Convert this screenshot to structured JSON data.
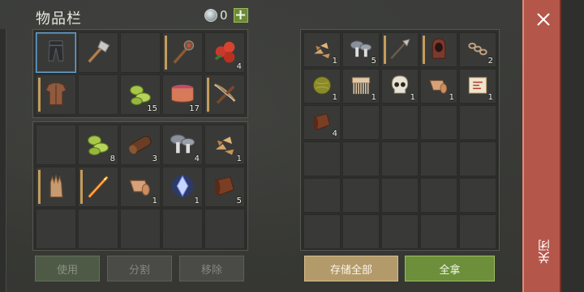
{
  "title": "物品栏",
  "currency": {
    "icon": "gem-icon",
    "count": "0",
    "add_label": "+"
  },
  "left_panel": {
    "equipment_slots": [
      {
        "icon": "pants-icon",
        "count": "",
        "selected": true,
        "marked": false
      },
      {
        "icon": "stone-axe-icon",
        "count": "",
        "selected": false,
        "marked": false
      },
      {
        "icon": "empty",
        "count": "",
        "selected": false,
        "marked": false
      },
      {
        "icon": "spiked-club-icon",
        "count": "",
        "selected": false,
        "marked": true
      },
      {
        "icon": "berries-icon",
        "count": "4",
        "selected": false,
        "marked": false
      },
      {
        "icon": "leather-armor-icon",
        "count": "",
        "selected": false,
        "marked": true
      },
      {
        "icon": "empty",
        "count": "",
        "selected": false,
        "marked": false
      },
      {
        "icon": "green-cloth-icon",
        "count": "15",
        "selected": false,
        "marked": false
      },
      {
        "icon": "bowl-icon",
        "count": "17",
        "selected": false,
        "marked": false
      },
      {
        "icon": "crossbow-icon",
        "count": "",
        "selected": false,
        "marked": true
      }
    ],
    "bag_slots": [
      {
        "icon": "empty",
        "count": ""
      },
      {
        "icon": "green-cloth-icon",
        "count": "8"
      },
      {
        "icon": "log-icon",
        "count": "3"
      },
      {
        "icon": "mushroom-icon",
        "count": "4"
      },
      {
        "icon": "wood-chips-icon",
        "count": "1"
      },
      {
        "icon": "glove-icon",
        "count": "",
        "marked": true
      },
      {
        "icon": "fire-sword-icon",
        "count": "",
        "marked": true
      },
      {
        "icon": "leather-roll-icon",
        "count": "1"
      },
      {
        "icon": "crystal-icon",
        "count": "1"
      },
      {
        "icon": "leather-scroll-icon",
        "count": "5"
      },
      {
        "icon": "empty",
        "count": ""
      },
      {
        "icon": "empty",
        "count": ""
      },
      {
        "icon": "empty",
        "count": ""
      },
      {
        "icon": "empty",
        "count": ""
      },
      {
        "icon": "empty",
        "count": ""
      }
    ],
    "buttons": {
      "use": "使用",
      "split": "分割",
      "remove": "移除"
    }
  },
  "right_panel": {
    "slots": [
      {
        "icon": "wood-chips-icon",
        "count": "1"
      },
      {
        "icon": "mushroom-icon",
        "count": "5"
      },
      {
        "icon": "halberd-icon",
        "count": "",
        "marked": true
      },
      {
        "icon": "hood-icon",
        "count": "",
        "marked": true
      },
      {
        "icon": "chain-icon",
        "count": "2"
      },
      {
        "icon": "moss-ball-icon",
        "count": "1"
      },
      {
        "icon": "comb-icon",
        "count": "1"
      },
      {
        "icon": "skull-icon",
        "count": "1"
      },
      {
        "icon": "leather-roll-icon",
        "count": "1"
      },
      {
        "icon": "map-scroll-icon",
        "count": "1"
      },
      {
        "icon": "leather-scroll-icon",
        "count": "4"
      },
      {
        "icon": "empty",
        "count": ""
      },
      {
        "icon": "empty",
        "count": ""
      },
      {
        "icon": "empty",
        "count": ""
      },
      {
        "icon": "empty",
        "count": ""
      },
      {
        "icon": "empty",
        "count": ""
      },
      {
        "icon": "empty",
        "count": ""
      },
      {
        "icon": "empty",
        "count": ""
      },
      {
        "icon": "empty",
        "count": ""
      },
      {
        "icon": "empty",
        "count": ""
      },
      {
        "icon": "empty",
        "count": ""
      },
      {
        "icon": "empty",
        "count": ""
      },
      {
        "icon": "empty",
        "count": ""
      },
      {
        "icon": "empty",
        "count": ""
      },
      {
        "icon": "empty",
        "count": ""
      },
      {
        "icon": "empty",
        "count": ""
      },
      {
        "icon": "empty",
        "count": ""
      },
      {
        "icon": "empty",
        "count": ""
      },
      {
        "icon": "empty",
        "count": ""
      },
      {
        "icon": "empty",
        "count": ""
      }
    ],
    "buttons": {
      "store_all": "存储全部",
      "take_all": "全拿"
    }
  },
  "close": {
    "icon": "close-icon",
    "label": "关闭"
  }
}
